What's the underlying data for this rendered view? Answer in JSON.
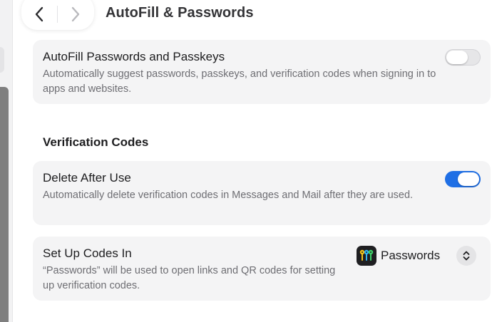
{
  "header": {
    "title": "AutoFill & Passwords",
    "back_icon": "chevron-left-icon",
    "forward_icon": "chevron-right-icon"
  },
  "autofill": {
    "title": "AutoFill Passwords and Passkeys",
    "description": "Automatically suggest passwords, passkeys, and verification codes when signing in to apps and websites.",
    "enabled": false
  },
  "verification": {
    "heading": "Verification Codes",
    "delete_after_use": {
      "title": "Delete After Use",
      "description": "Automatically delete verification codes in Messages and Mail after they are used.",
      "enabled": true
    },
    "set_up_codes_in": {
      "title": "Set Up Codes In",
      "description": "“Passwords” will be used to open links and QR codes for setting up verification codes.",
      "selected_app": "Passwords",
      "app_icon": "passwords-app-icon"
    }
  },
  "colors": {
    "accent": "#1f6fe5",
    "card_background": "#f4f4f5",
    "secondary_text": "#6e6e73"
  }
}
